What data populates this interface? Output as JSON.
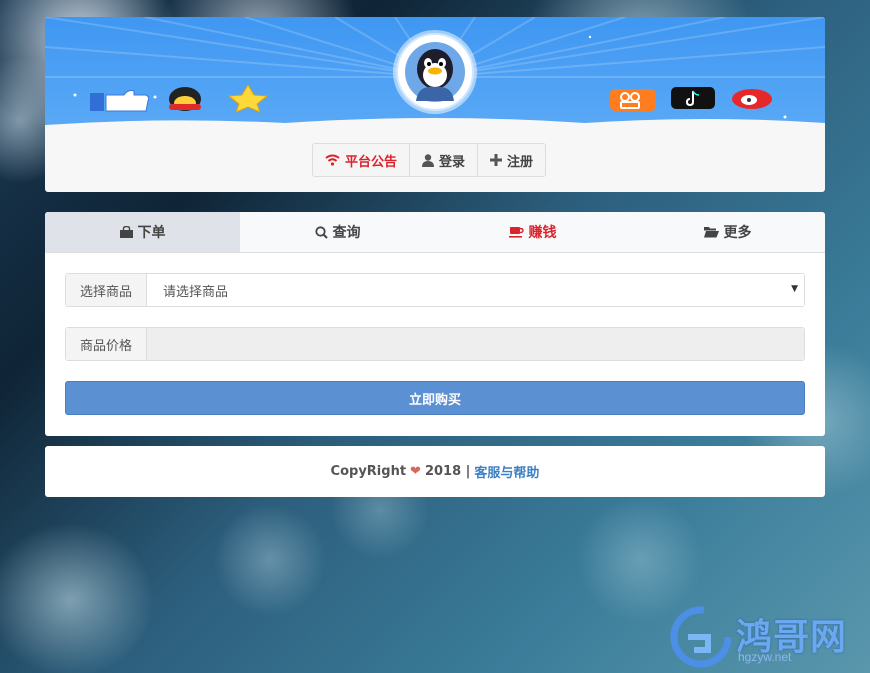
{
  "header": {
    "buttons": [
      {
        "label": "平台公告",
        "icon": "wifi-icon",
        "color": "#d9232d"
      },
      {
        "label": "登录",
        "icon": "user-icon"
      },
      {
        "label": "注册",
        "icon": "plus-icon"
      }
    ]
  },
  "tabs": [
    {
      "label": "下单",
      "icon": "shopping-bag-icon",
      "active": true
    },
    {
      "label": "查询",
      "icon": "search-icon"
    },
    {
      "label": "赚钱",
      "icon": "coffee-icon",
      "color": "#d9232d"
    },
    {
      "label": "更多",
      "icon": "folder-open-icon"
    }
  ],
  "form": {
    "product_label": "选择商品",
    "product_value": "请选择商品",
    "price_label": "商品价格",
    "price_value": "",
    "buy_label": "立即购买"
  },
  "footer": {
    "copyright": "CopyRight",
    "year": "2018 |",
    "help_link": "客服与帮助"
  },
  "watermark": {
    "title": "鸿哥网",
    "url": "hgzyw.net"
  },
  "colors": {
    "accent": "#5b90d2",
    "danger": "#d9232d",
    "banner": "#4a9ff4"
  }
}
